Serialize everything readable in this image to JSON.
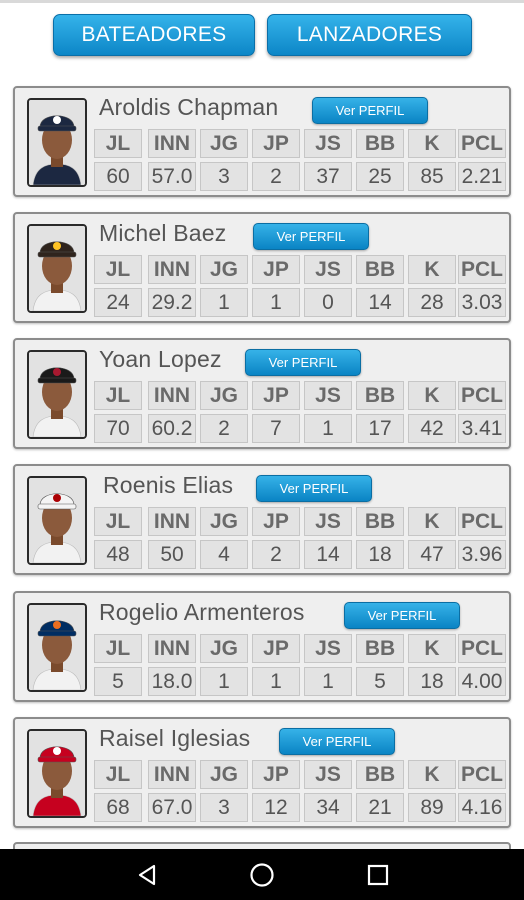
{
  "tabs": [
    {
      "label": "BATEADORES"
    },
    {
      "label": "LANZADORES"
    }
  ],
  "stat_headers": [
    "JL",
    "INN",
    "JG",
    "JP",
    "JS",
    "BB",
    "K",
    "PCL"
  ],
  "view_profile_label": "Ver PERFIL",
  "players": [
    {
      "name": "Aroldis Chapman",
      "team_icon": "yankees-cap-icon",
      "cap_color": "#1c2841",
      "logo_color": "#ffffff",
      "jersey_color": "#1c2841",
      "stats": [
        "60",
        "57.0",
        "3",
        "2",
        "37",
        "25",
        "85",
        "2.21"
      ]
    },
    {
      "name": "Michel Baez",
      "team_icon": "padres-cap-icon",
      "cap_color": "#2f241d",
      "logo_color": "#ffc425",
      "jersey_color": "#f2f2f2",
      "stats": [
        "24",
        "29.2",
        "1",
        "1",
        "0",
        "14",
        "28",
        "3.03"
      ]
    },
    {
      "name": "Yoan Lopez",
      "team_icon": "diamondbacks-cap-icon",
      "cap_color": "#1a1a1a",
      "logo_color": "#a71930",
      "jersey_color": "#f2f2f2",
      "stats": [
        "70",
        "60.2",
        "2",
        "7",
        "1",
        "17",
        "42",
        "3.41"
      ]
    },
    {
      "name": "Roenis Elias",
      "team_icon": "nationals-cap-icon",
      "cap_color": "#f4f4f4",
      "logo_color": "#ab0003",
      "jersey_color": "#f2f2f2",
      "stats": [
        "48",
        "50",
        "4",
        "2",
        "14",
        "18",
        "47",
        "3.96"
      ]
    },
    {
      "name": "Rogelio Armenteros",
      "team_icon": "astros-cap-icon",
      "cap_color": "#002d62",
      "logo_color": "#eb6e1f",
      "jersey_color": "#f2f2f2",
      "stats": [
        "5",
        "18.0",
        "1",
        "1",
        "1",
        "5",
        "18",
        "4.00"
      ]
    },
    {
      "name": "Raisel Iglesias",
      "team_icon": "reds-cap-icon",
      "cap_color": "#c6011f",
      "logo_color": "#ffffff",
      "jersey_color": "#c6011f",
      "stats": [
        "68",
        "67.0",
        "3",
        "12",
        "34",
        "21",
        "89",
        "4.16"
      ]
    }
  ],
  "nav": [
    "back-icon",
    "home-icon",
    "recents-icon"
  ]
}
